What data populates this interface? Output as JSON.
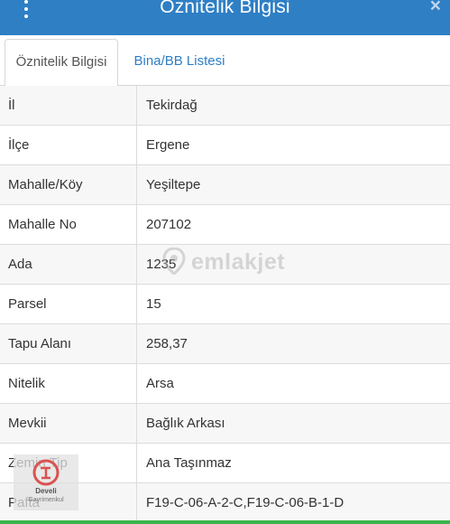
{
  "header": {
    "title": "Öznitelik Bilgisi",
    "close_label": "×"
  },
  "tabs": [
    {
      "label": "Öznitelik Bilgisi",
      "active": true
    },
    {
      "label": "Bina/BB Listesi",
      "active": false
    }
  ],
  "rows": [
    {
      "label": "İl",
      "value": "Tekirdağ"
    },
    {
      "label": "İlçe",
      "value": "Ergene"
    },
    {
      "label": "Mahalle/Köy",
      "value": "Yeşiltepe"
    },
    {
      "label": "Mahalle No",
      "value": "207102"
    },
    {
      "label": "Ada",
      "value": "1235"
    },
    {
      "label": "Parsel",
      "value": "15"
    },
    {
      "label": "Tapu Alanı",
      "value": "258,37"
    },
    {
      "label": "Nitelik",
      "value": "Arsa"
    },
    {
      "label": "Mevkii",
      "value": "Bağlık Arkası"
    },
    {
      "label": "Zemin Tip",
      "value": "Ana Taşınmaz"
    },
    {
      "label": "Pafta",
      "value": "F19-C-06-A-2-C,F19-C-06-B-1-D"
    }
  ],
  "watermark": {
    "text": "emlakjet"
  },
  "agency_logo": {
    "line1": "Develi",
    "line2": "Gayrimenkul"
  },
  "colors": {
    "header_bg": "#2f7fc5",
    "tab_link": "#2f7fc5",
    "row_alt_bg": "#f7f7f7",
    "border": "#dcdcdc",
    "bottom_bar": "#39b54a"
  }
}
